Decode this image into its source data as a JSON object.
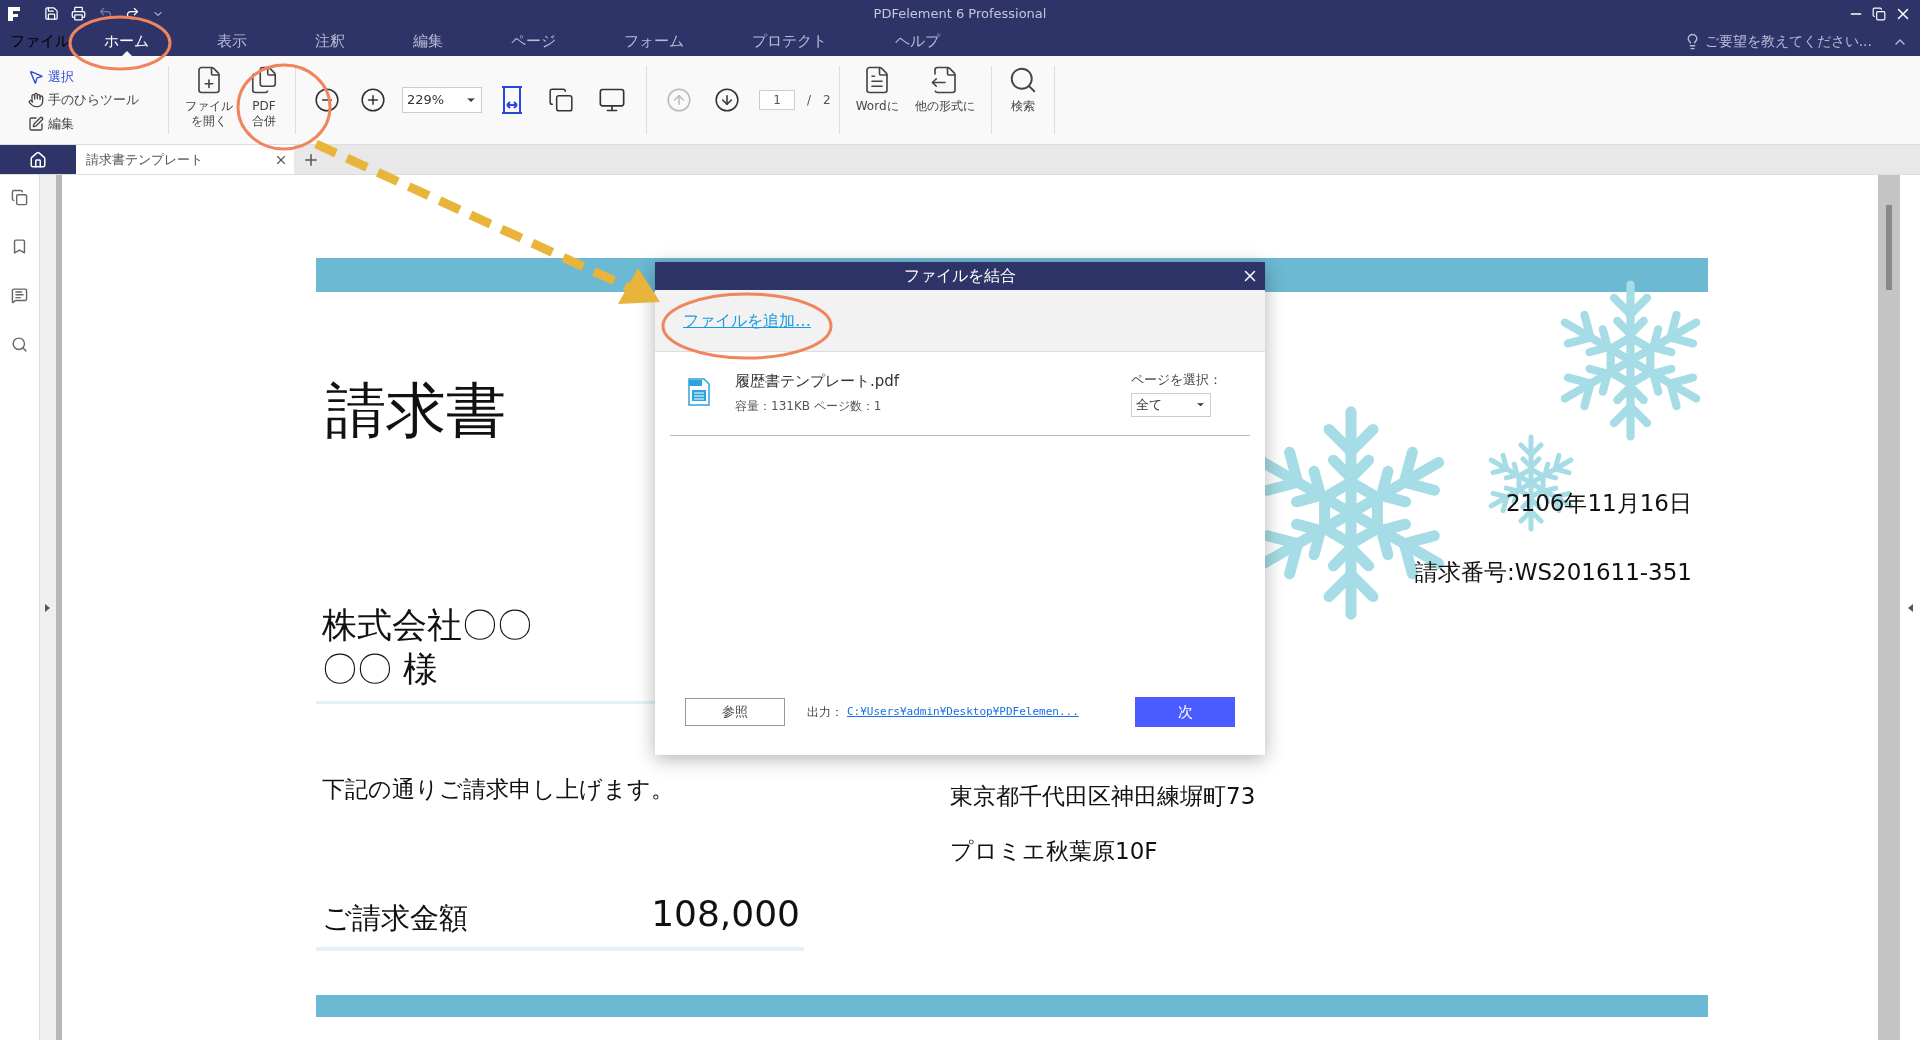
{
  "window": {
    "title": "PDFelement 6 Professional"
  },
  "menu": [
    {
      "label": "ファイル",
      "selected": false
    },
    {
      "label": "ホーム",
      "selected": true
    },
    {
      "label": "表示",
      "selected": false
    },
    {
      "label": "注釈",
      "selected": false
    },
    {
      "label": "編集",
      "selected": false
    },
    {
      "label": "ページ",
      "selected": false
    },
    {
      "label": "フォーム",
      "selected": false
    },
    {
      "label": "プロテクト",
      "selected": false
    },
    {
      "label": "ヘルプ",
      "selected": false
    }
  ],
  "help_search": {
    "placeholder": "ご要望を教えてください..."
  },
  "ribbon": {
    "modes": [
      {
        "kind": "select",
        "label": "選択",
        "selected": true
      },
      {
        "kind": "hand",
        "label": "手のひらツール",
        "selected": false
      },
      {
        "kind": "edit",
        "label": "編集",
        "selected": false
      }
    ],
    "groups": [
      [
        {
          "kind": "open",
          "lines": [
            "ファイル",
            "を開く"
          ]
        },
        {
          "kind": "merge",
          "lines": [
            "PDF",
            "合併"
          ]
        }
      ],
      [
        {
          "kind": "zoom_out"
        },
        {
          "kind": "zoom_in"
        },
        {
          "kind": "zoom_select",
          "value": "229%"
        },
        {
          "kind": "fit_width"
        },
        {
          "kind": "page_tool"
        },
        {
          "kind": "fullscreen"
        }
      ],
      [
        {
          "kind": "prev_page",
          "disabled": true
        },
        {
          "kind": "next_page",
          "disabled": false
        },
        {
          "kind": "page_field",
          "value": "1",
          "separator": "/",
          "total": "2"
        }
      ],
      [
        {
          "kind": "to_word",
          "lines": [
            "Wordに"
          ]
        },
        {
          "kind": "to_other",
          "lines": [
            "他の形式に"
          ]
        }
      ],
      [
        {
          "kind": "search",
          "lines": [
            "検索"
          ]
        }
      ]
    ]
  },
  "tabs": [
    {
      "kind": "home"
    },
    {
      "kind": "document",
      "label": "請求書テンプレート",
      "selected": true
    }
  ],
  "document": {
    "title": "請求書",
    "recipient": [
      "株式会社〇〇",
      "〇〇 様"
    ],
    "message": "下記の通りご請求申し上げます。",
    "amount_label": "ご請求金額",
    "amount": "108,000",
    "date": "2106年11月16日",
    "invoice_number": "請求番号:WS201611-351",
    "address": [
      "東京都千代田区神田練塀町73",
      "プロミエ秋葉原10F"
    ]
  },
  "dialog": {
    "title": "ファイルを結合",
    "add_link": "ファイルを追加…",
    "files": [
      {
        "name": "履歴書テンプレート.pdf",
        "details": "容量：131KB ページ数：1",
        "page_label": "ページを選択：",
        "page_choice": "全て"
      }
    ],
    "browse": "参照",
    "output_label": "出力：",
    "output_path": "C:¥Users¥admin¥Desktop¥PDFelemen...",
    "next": "次"
  }
}
